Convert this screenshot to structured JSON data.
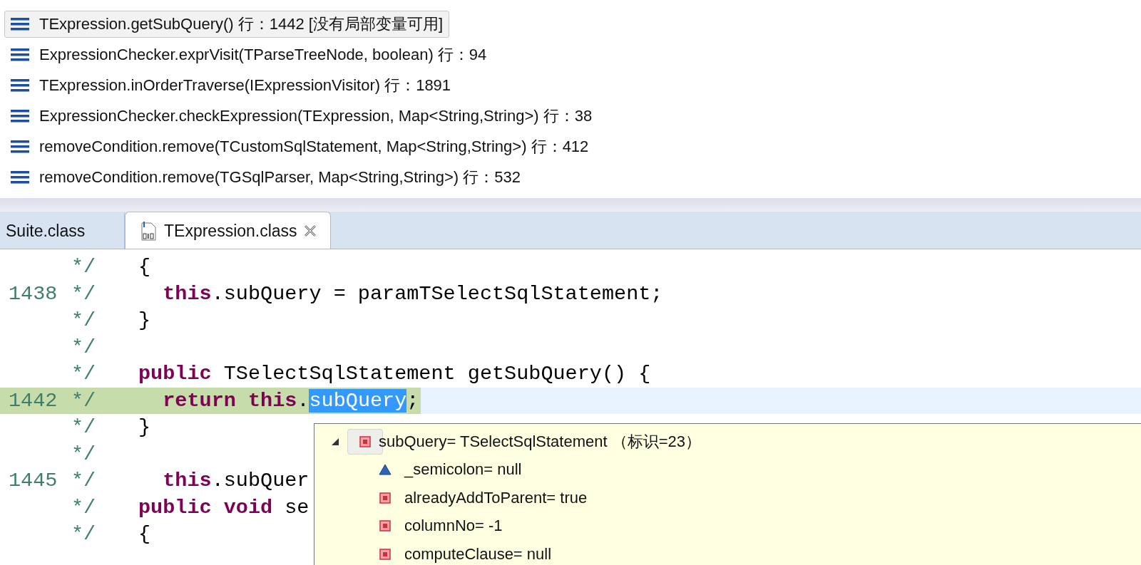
{
  "stack_frames": [
    {
      "label": "TExpression.getSubQuery() 行：1442 [没有局部变量可用]",
      "selected": true
    },
    {
      "label": "ExpressionChecker.exprVisit(TParseTreeNode, boolean) 行：94",
      "selected": false
    },
    {
      "label": "TExpression.inOrderTraverse(IExpressionVisitor) 行：1891",
      "selected": false
    },
    {
      "label": "ExpressionChecker.checkExpression(TExpression, Map<String,String>) 行：38",
      "selected": false
    },
    {
      "label": "removeCondition.remove(TCustomSqlStatement, Map<String,String>) 行：412",
      "selected": false
    },
    {
      "label": "removeCondition.remove(TGSqlParser, Map<String,String>) 行：532",
      "selected": false
    }
  ],
  "editor_tabs": [
    {
      "label": "Suite.class",
      "selected": false
    },
    {
      "label": "TExpression.class",
      "selected": true
    }
  ],
  "code_lines": [
    {
      "marker": "*/",
      "code": "{",
      "current": false
    },
    {
      "number": "1438",
      "marker": "*/",
      "code": "  **this**.subQuery = paramTSelectSqlStatement;",
      "current": false
    },
    {
      "marker": "*/",
      "code": "}",
      "current": false
    },
    {
      "marker": "*/",
      "current": false
    },
    {
      "marker": "*/",
      "code": "**public** TSelectSqlStatement getSubQuery() {",
      "current": false
    },
    {
      "number": "1442",
      "marker": "*/",
      "code": "  **return** **this**.",
      "selection": "subQuery",
      "after": ";",
      "current": true
    },
    {
      "marker": "*/",
      "code": "}",
      "current": false
    },
    {
      "marker": "*/",
      "current": false
    },
    {
      "number": "1445",
      "marker": "*/",
      "code": "  **this**.subQuer",
      "current": false
    },
    {
      "marker": "*/",
      "code": "**public** **void** se",
      "current": false
    },
    {
      "marker": "*/",
      "code": "{",
      "current": false
    }
  ],
  "hover_popup": {
    "root": {
      "label": "subQuery= TSelectSqlStatement （标识=23）",
      "kind": "private",
      "expanded": true,
      "children": [
        {
          "label": "_semicolon= null",
          "kind": "default"
        },
        {
          "label": "alreadyAddToParent= true",
          "kind": "private"
        },
        {
          "label": "columnNo= -1",
          "kind": "private"
        },
        {
          "label": "computeClause= null",
          "kind": "private"
        }
      ]
    }
  }
}
